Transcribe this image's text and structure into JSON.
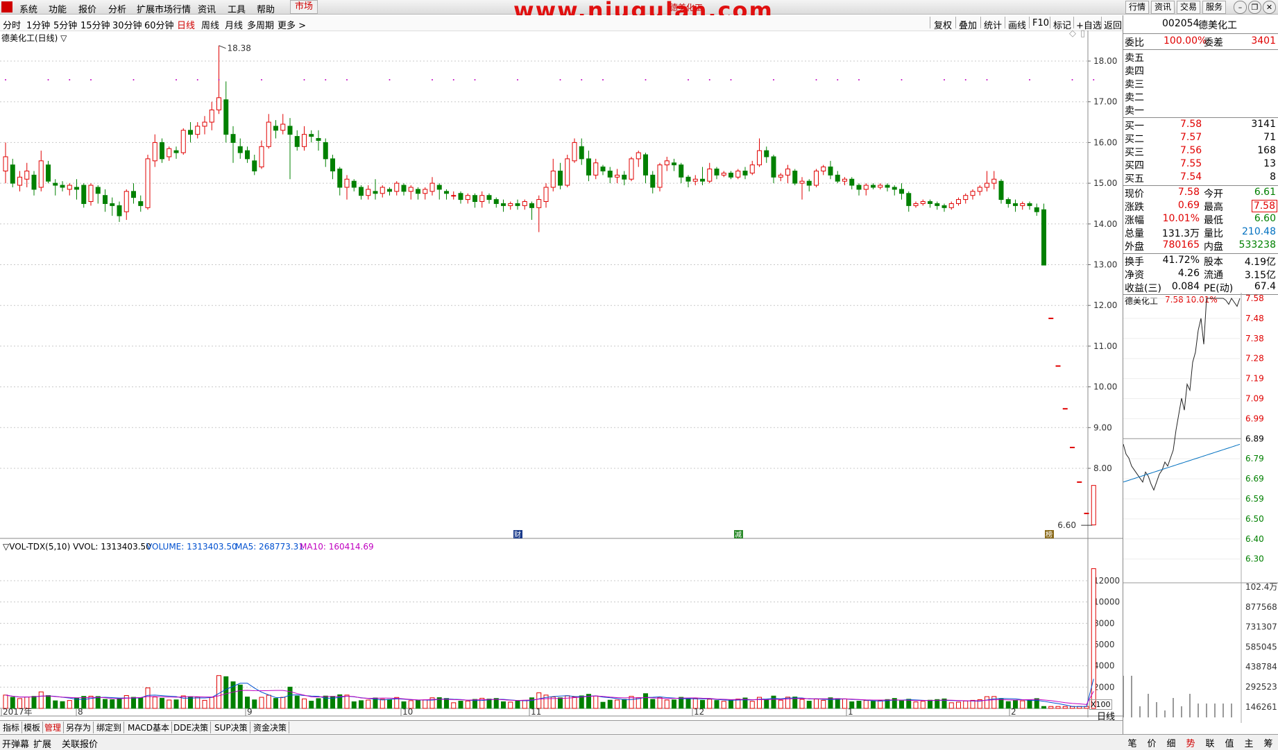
{
  "menu": {
    "items": [
      "系统",
      "功能",
      "报价",
      "分析",
      "扩展市场行情",
      "资讯",
      "工具",
      "帮助"
    ],
    "active": "市场",
    "site_watermark": "www.niugulan.com",
    "title_text": "德美化工",
    "right_buttons": [
      "行情",
      "资讯",
      "交易",
      "服务"
    ]
  },
  "toolbar": {
    "periods": [
      "分时",
      "1分钟",
      "5分钟",
      "15分钟",
      "30分钟",
      "60分钟",
      "日线",
      "周线",
      "月线",
      "多周期",
      "更多 >"
    ],
    "selected_period": "日线",
    "tools": [
      "复权",
      "叠加",
      "统计",
      "画线",
      "F10",
      "标记",
      "+自选",
      "返回"
    ]
  },
  "chart": {
    "stock_label": "德美化工(日线) ▽",
    "high_marker": "18.38",
    "low_marker": "6.60",
    "event_badges": [
      "财",
      "减",
      "榜"
    ],
    "volume_header": {
      "indicator": "▽VOL-TDX(5,10) VVOL: 1313403.50",
      "volume": "VOLUME: 1313403.50",
      "ma5": "MA5: 268773.31",
      "ma10": "MA10: 160414.69"
    },
    "x100_label": "X100",
    "period_tag": "日线",
    "zoom_in": "+",
    "zoom_out": "-",
    "time_labels": [
      "2017年",
      "8",
      "9",
      "10",
      "11",
      "12",
      "1",
      "2"
    ]
  },
  "chart_data": [
    {
      "type": "candlestick",
      "title": "德美化工(日线)",
      "y_ticks": [
        18.0,
        17.0,
        16.0,
        15.0,
        14.0,
        13.0,
        12.0,
        11.0,
        10.0,
        9.0,
        8.0
      ],
      "ylim": [
        6.6,
        18.38
      ],
      "grid": true,
      "candles": [
        [
          15.3,
          15.65,
          15.0,
          16.0
        ],
        [
          15.45,
          15.0,
          14.9,
          15.6
        ],
        [
          14.95,
          15.15,
          14.8,
          15.3
        ],
        [
          15.1,
          15.3,
          14.9,
          15.5
        ],
        [
          15.2,
          14.85,
          14.7,
          15.3
        ],
        [
          14.9,
          15.55,
          14.8,
          15.8
        ],
        [
          15.45,
          15.05,
          15.0,
          15.55
        ],
        [
          15.0,
          14.95,
          14.7,
          15.1
        ],
        [
          14.95,
          14.9,
          14.8,
          15.05
        ],
        [
          14.85,
          14.95,
          14.7,
          15.0
        ],
        [
          14.9,
          14.85,
          14.6,
          15.1
        ],
        [
          14.95,
          14.5,
          14.4,
          15.0
        ],
        [
          14.55,
          14.95,
          14.45,
          15.0
        ],
        [
          14.9,
          14.75,
          14.5,
          14.95
        ],
        [
          14.7,
          14.5,
          14.3,
          14.85
        ],
        [
          14.5,
          14.45,
          14.2,
          14.65
        ],
        [
          14.45,
          14.2,
          14.05,
          14.55
        ],
        [
          14.3,
          14.8,
          14.1,
          14.85
        ],
        [
          14.8,
          14.65,
          14.5,
          15.0
        ],
        [
          14.55,
          14.45,
          14.3,
          14.7
        ],
        [
          14.4,
          15.6,
          14.35,
          15.7
        ],
        [
          15.55,
          16.0,
          15.4,
          16.2
        ],
        [
          16.0,
          15.6,
          15.5,
          16.1
        ],
        [
          15.65,
          15.85,
          15.55,
          15.9
        ],
        [
          15.8,
          15.75,
          15.6,
          15.9
        ],
        [
          15.75,
          16.3,
          15.7,
          16.35
        ],
        [
          16.3,
          16.2,
          16.0,
          16.5
        ],
        [
          16.2,
          16.4,
          16.1,
          16.5
        ],
        [
          16.4,
          16.5,
          16.2,
          16.65
        ],
        [
          16.5,
          16.8,
          16.3,
          17.0
        ],
        [
          16.8,
          17.1,
          16.7,
          18.38
        ],
        [
          17.05,
          16.2,
          16.0,
          17.5
        ],
        [
          16.2,
          16.0,
          15.5,
          16.4
        ],
        [
          15.9,
          15.75,
          15.6,
          16.1
        ],
        [
          15.8,
          15.6,
          15.5,
          15.9
        ],
        [
          15.55,
          15.3,
          15.2,
          15.7
        ],
        [
          15.4,
          15.9,
          15.35,
          16.05
        ],
        [
          15.9,
          16.5,
          15.85,
          16.7
        ],
        [
          16.4,
          16.3,
          16.1,
          16.55
        ],
        [
          16.3,
          16.45,
          16.2,
          16.7
        ],
        [
          16.4,
          16.2,
          15.1,
          16.6
        ],
        [
          16.15,
          15.9,
          15.8,
          16.3
        ],
        [
          15.9,
          16.2,
          15.8,
          16.4
        ],
        [
          16.2,
          16.15,
          16.0,
          16.3
        ],
        [
          16.1,
          16.05,
          15.8,
          16.3
        ],
        [
          16.0,
          15.6,
          15.4,
          16.1
        ],
        [
          15.6,
          15.3,
          15.1,
          15.7
        ],
        [
          15.35,
          14.9,
          14.7,
          15.4
        ],
        [
          14.9,
          15.1,
          14.6,
          15.2
        ],
        [
          15.05,
          14.9,
          14.8,
          15.1
        ],
        [
          14.9,
          14.7,
          14.6,
          14.95
        ],
        [
          14.7,
          14.85,
          14.6,
          14.95
        ],
        [
          14.8,
          14.75,
          14.6,
          15.1
        ],
        [
          14.75,
          14.9,
          14.65,
          14.95
        ],
        [
          14.85,
          14.8,
          14.7,
          14.9
        ],
        [
          14.8,
          15.0,
          14.7,
          15.05
        ],
        [
          14.95,
          14.8,
          14.7,
          15.0
        ],
        [
          14.8,
          14.9,
          14.6,
          14.95
        ],
        [
          14.85,
          14.75,
          14.6,
          14.9
        ],
        [
          14.75,
          14.85,
          14.6,
          14.9
        ],
        [
          14.8,
          15.0,
          14.7,
          15.15
        ],
        [
          14.95,
          14.85,
          14.6,
          15.0
        ],
        [
          14.8,
          14.75,
          14.6,
          14.85
        ],
        [
          14.7,
          14.7,
          14.6,
          14.8
        ],
        [
          14.75,
          14.6,
          14.5,
          14.8
        ],
        [
          14.6,
          14.7,
          14.5,
          14.75
        ],
        [
          14.7,
          14.55,
          14.4,
          14.75
        ],
        [
          14.55,
          14.7,
          14.4,
          14.8
        ],
        [
          14.7,
          14.6,
          14.5,
          14.75
        ],
        [
          14.6,
          14.5,
          14.4,
          14.65
        ],
        [
          14.5,
          14.45,
          14.3,
          14.6
        ],
        [
          14.45,
          14.5,
          14.35,
          14.55
        ],
        [
          14.5,
          14.45,
          14.35,
          14.6
        ],
        [
          14.45,
          14.55,
          14.35,
          14.6
        ],
        [
          14.5,
          14.4,
          14.1,
          14.55
        ],
        [
          14.4,
          14.6,
          13.8,
          14.7
        ],
        [
          14.55,
          14.9,
          14.4,
          15.0
        ],
        [
          14.9,
          15.3,
          14.8,
          15.6
        ],
        [
          15.3,
          14.95,
          14.85,
          15.5
        ],
        [
          14.95,
          15.6,
          14.9,
          15.7
        ],
        [
          15.55,
          16.0,
          15.5,
          16.1
        ],
        [
          15.9,
          15.6,
          15.45,
          16.1
        ],
        [
          15.6,
          15.2,
          15.05,
          15.8
        ],
        [
          15.2,
          15.5,
          15.1,
          15.6
        ],
        [
          15.4,
          15.3,
          15.2,
          15.45
        ],
        [
          15.3,
          15.15,
          15.0,
          15.4
        ],
        [
          15.15,
          15.2,
          15.0,
          15.35
        ],
        [
          15.2,
          15.1,
          14.95,
          15.3
        ],
        [
          15.1,
          15.6,
          15.05,
          15.65
        ],
        [
          15.6,
          15.75,
          15.4,
          15.8
        ],
        [
          15.7,
          15.2,
          15.0,
          15.75
        ],
        [
          15.2,
          14.9,
          14.75,
          15.3
        ],
        [
          14.9,
          15.45,
          14.8,
          15.5
        ],
        [
          15.45,
          15.55,
          15.3,
          15.65
        ],
        [
          15.5,
          15.45,
          15.3,
          15.6
        ],
        [
          15.45,
          15.15,
          15.0,
          15.5
        ],
        [
          15.15,
          15.05,
          14.9,
          15.2
        ],
        [
          15.05,
          15.1,
          14.95,
          15.2
        ],
        [
          15.1,
          15.05,
          14.95,
          15.4
        ],
        [
          15.05,
          15.35,
          15.0,
          15.5
        ],
        [
          15.35,
          15.2,
          15.1,
          15.4
        ],
        [
          15.2,
          15.25,
          15.15,
          15.3
        ],
        [
          15.25,
          15.15,
          15.1,
          15.3
        ],
        [
          15.15,
          15.3,
          15.1,
          15.35
        ],
        [
          15.3,
          15.2,
          15.1,
          15.4
        ],
        [
          15.25,
          15.45,
          15.2,
          15.55
        ],
        [
          15.45,
          15.8,
          15.4,
          16.1
        ],
        [
          15.8,
          15.65,
          15.5,
          15.9
        ],
        [
          15.65,
          15.15,
          15.0,
          15.7
        ],
        [
          15.15,
          15.2,
          15.05,
          15.25
        ],
        [
          15.2,
          15.35,
          15.0,
          15.45
        ],
        [
          15.3,
          15.0,
          14.95,
          15.35
        ],
        [
          15.0,
          15.05,
          14.6,
          15.15
        ],
        [
          15.05,
          14.95,
          14.8,
          15.1
        ],
        [
          14.95,
          15.3,
          14.9,
          15.35
        ],
        [
          15.3,
          15.4,
          15.2,
          15.45
        ],
        [
          15.4,
          15.2,
          15.1,
          15.55
        ],
        [
          15.2,
          15.05,
          15.0,
          15.3
        ],
        [
          15.05,
          15.1,
          14.95,
          15.15
        ],
        [
          15.1,
          14.95,
          14.85,
          15.15
        ],
        [
          14.95,
          14.85,
          14.7,
          15.0
        ],
        [
          14.85,
          14.95,
          14.7,
          15.0
        ],
        [
          14.95,
          14.9,
          14.85,
          15.0
        ],
        [
          14.9,
          14.95,
          14.85,
          15.0
        ],
        [
          14.95,
          14.9,
          14.8,
          15.0
        ],
        [
          14.9,
          14.85,
          14.7,
          14.95
        ],
        [
          14.85,
          14.75,
          14.6,
          15.0
        ],
        [
          14.75,
          14.45,
          14.3,
          14.8
        ],
        [
          14.45,
          14.5,
          14.4,
          14.55
        ],
        [
          14.5,
          14.55,
          14.45,
          14.6
        ],
        [
          14.55,
          14.5,
          14.4,
          14.6
        ],
        [
          14.5,
          14.45,
          14.35,
          14.55
        ],
        [
          14.45,
          14.4,
          14.3,
          14.5
        ],
        [
          14.4,
          14.5,
          14.35,
          14.55
        ],
        [
          14.5,
          14.6,
          14.45,
          14.65
        ],
        [
          14.6,
          14.7,
          14.5,
          14.75
        ],
        [
          14.7,
          14.8,
          14.6,
          14.85
        ],
        [
          14.8,
          14.9,
          14.7,
          14.95
        ],
        [
          14.9,
          15.0,
          14.8,
          15.3
        ],
        [
          15.0,
          15.1,
          14.85,
          15.3
        ],
        [
          15.05,
          14.6,
          14.5,
          15.1
        ],
        [
          14.6,
          14.5,
          14.4,
          14.65
        ],
        [
          14.5,
          14.45,
          14.3,
          14.6
        ],
        [
          14.45,
          14.5,
          14.35,
          14.55
        ],
        [
          14.5,
          14.45,
          14.35,
          14.55
        ],
        [
          14.4,
          14.3,
          14.2,
          14.5
        ],
        [
          14.35,
          12.99,
          12.99,
          14.5
        ],
        [
          11.69,
          11.69,
          11.69,
          11.69
        ],
        [
          10.52,
          10.52,
          10.52,
          10.52
        ],
        [
          9.47,
          9.47,
          9.47,
          9.47
        ],
        [
          8.52,
          8.52,
          8.52,
          8.52
        ],
        [
          7.67,
          7.67,
          7.67,
          7.67
        ],
        [
          6.9,
          6.9,
          6.9,
          6.9
        ],
        [
          6.61,
          7.58,
          6.6,
          7.58
        ]
      ]
    },
    {
      "type": "bar",
      "title": "VOL-TDX(5,10)",
      "y_ticks": [
        12000,
        10000,
        8000,
        6000,
        4000,
        2000
      ],
      "ylim": [
        0,
        13500
      ],
      "multiplier": "X100",
      "series_latest": {
        "VOLUME": 1313403.5,
        "MA5": 268773.31,
        "MA10": 160414.69
      }
    },
    {
      "type": "line",
      "title": "德美化工 分时",
      "price_ticks": [
        7.58,
        7.48,
        7.38,
        7.28,
        7.19,
        7.09,
        6.99,
        6.89,
        6.79,
        6.69,
        6.59,
        6.5,
        6.4,
        6.3
      ],
      "volume_ticks": [
        "102.4万",
        "877568",
        "731307",
        "585045",
        "438784",
        "292523",
        "146261"
      ],
      "ylim": [
        6.3,
        7.58
      ]
    }
  ],
  "quote": {
    "code": "002054",
    "name": "德美化工",
    "weibi_label": "委比",
    "weibi": "100.00%",
    "weicha_label": "委差",
    "weicha": "3401",
    "sell": [
      {
        "label": "卖五",
        "price": "",
        "vol": ""
      },
      {
        "label": "卖四",
        "price": "",
        "vol": ""
      },
      {
        "label": "卖三",
        "price": "",
        "vol": ""
      },
      {
        "label": "卖二",
        "price": "",
        "vol": ""
      },
      {
        "label": "卖一",
        "price": "",
        "vol": ""
      }
    ],
    "buy": [
      {
        "label": "买一",
        "price": "7.58",
        "vol": "3141"
      },
      {
        "label": "买二",
        "price": "7.57",
        "vol": "71"
      },
      {
        "label": "买三",
        "price": "7.56",
        "vol": "168"
      },
      {
        "label": "买四",
        "price": "7.55",
        "vol": "13"
      },
      {
        "label": "买五",
        "price": "7.54",
        "vol": "8"
      }
    ],
    "stats": [
      {
        "l1": "现价",
        "v1": "7.58",
        "l2": "今开",
        "v2": "6.61",
        "c1": "red",
        "c2": "green"
      },
      {
        "l1": "涨跌",
        "v1": "0.69",
        "l2": "最高",
        "v2": "7.58",
        "c1": "red",
        "c2": "red"
      },
      {
        "l1": "涨幅",
        "v1": "10.01%",
        "l2": "最低",
        "v2": "6.60",
        "c1": "red",
        "c2": "green"
      },
      {
        "l1": "总量",
        "v1": "131.3万",
        "l2": "量比",
        "v2": "210.48",
        "c1": "black",
        "c2": "blue"
      },
      {
        "l1": "外盘",
        "v1": "780165",
        "l2": "内盘",
        "v2": "533238",
        "c1": "red",
        "c2": "green"
      }
    ],
    "stats2": [
      {
        "l1": "换手",
        "v1": "41.72%",
        "l2": "股本",
        "v2": "4.19亿"
      },
      {
        "l1": "净资",
        "v1": "4.26",
        "l2": "流通",
        "v2": "3.15亿"
      },
      {
        "l1": "收益(三)",
        "v1": "0.084",
        "l2": "PE(动)",
        "v2": "67.4"
      }
    ],
    "mini_title": "德美化工",
    "mini_price": "7.58",
    "mini_pct": "10.01%"
  },
  "bottom_tabs": [
    "指标",
    "模板",
    "管理",
    "另存为",
    "绑定到",
    "MACD基本",
    "DDE决策",
    "SUP决策",
    "资金决策"
  ],
  "bottom_tab_selected": "管理",
  "status": [
    "开弹幕",
    "扩展",
    "关联报价"
  ],
  "right_tabs": [
    "笔",
    "价",
    "细",
    "势",
    "联",
    "值",
    "主",
    "筹"
  ],
  "right_tab_selected": "势",
  "colors": {
    "up": "#e00000",
    "down": "#008000",
    "ma5": "#0050d0",
    "ma10": "#c000c0",
    "grid": "#c8c8c8",
    "accent": "#d00000"
  }
}
